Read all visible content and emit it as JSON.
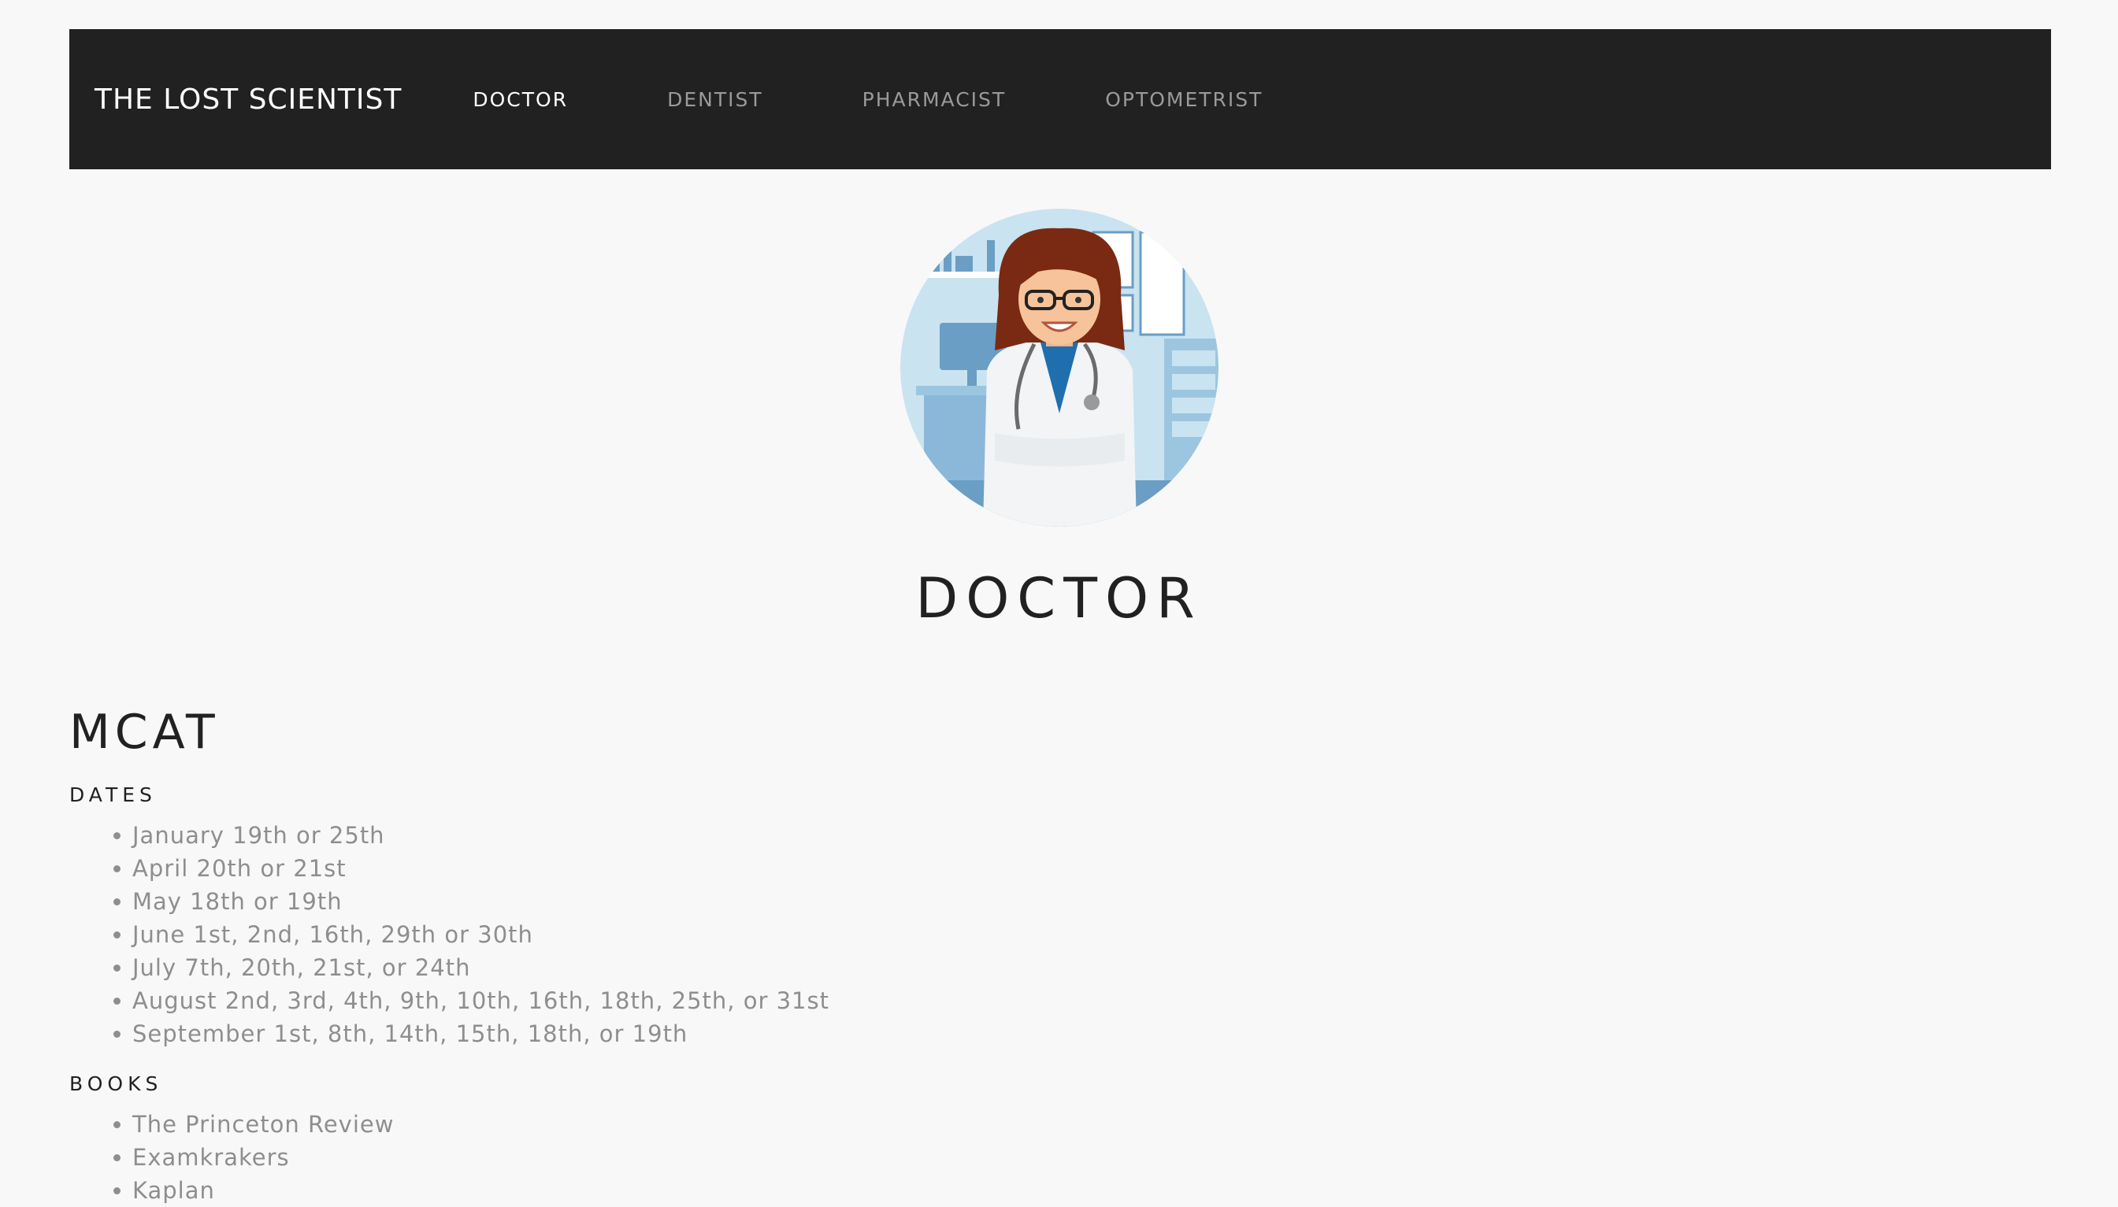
{
  "nav": {
    "brand": "THE LOST SCIENTIST",
    "links": [
      "DOCTOR",
      "DENTIST",
      "PHARMACIST",
      "OPTOMETRIST"
    ],
    "active": "DOCTOR"
  },
  "hero": {
    "image_icon": "doctor-illustration-icon",
    "title": "DOCTOR"
  },
  "section": {
    "title": "MCAT",
    "dates_heading": "DATES",
    "dates": [
      "January 19th or 25th",
      "April 20th or 21st",
      "May 18th or 19th",
      "June 1st, 2nd, 16th, 29th or 30th",
      "July 7th, 20th, 21st, or 24th",
      "August 2nd, 3rd, 4th, 9th, 10th, 16th, 18th, 25th, or 31st",
      "September 1st, 8th, 14th, 15th, 18th, or 19th"
    ],
    "books_heading": "BOOKS",
    "books": [
      "The Princeton Review",
      "Examkrakers",
      "Kaplan"
    ]
  },
  "colors": {
    "navbar_bg": "#212121",
    "page_bg": "#f8f8f8",
    "text_dark": "#212121",
    "text_muted": "#8e8e8e",
    "nav_inactive": "#9a9a9a"
  }
}
